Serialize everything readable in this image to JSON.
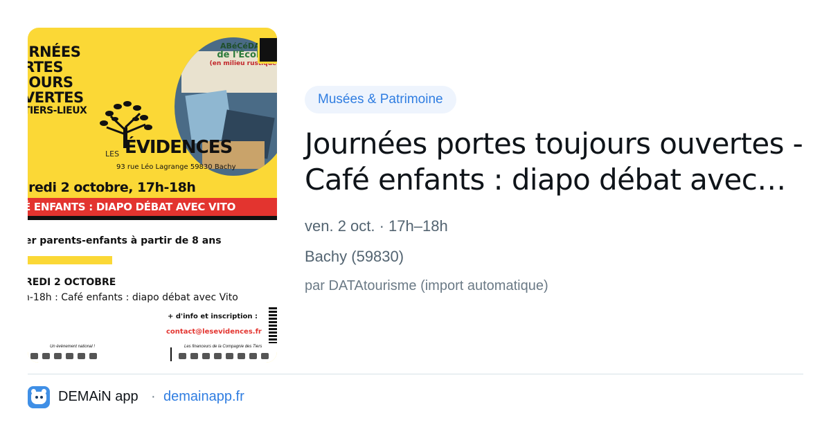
{
  "poster": {
    "title_lines": [
      "JRNÉES",
      "RTES",
      "JOURS",
      "VERTES",
      "TIERS-LIEUX"
    ],
    "circle_lines": [
      "ABéCéDAIR",
      "de l'Écolog",
      "(en milieu rustique)"
    ],
    "org_prefix": "LES",
    "org_name": "ÉVIDENCES",
    "address": "93 rue Léo Lagrange 59830 Bachy",
    "date_line": "dredi 2 octobre, 17h-18h",
    "red_banner": "É ENFANTS : DIAPO DÉBAT AVEC VITO",
    "audience": "er parents-enfants à partir de 8 ans",
    "day_heading": "REDI 2 OCTOBRE",
    "day_detail": "h-18h : Café enfants : diapo débat avec Vito",
    "info_label": "+ d'info et inscription :",
    "contact": "contact@lesevidences.fr",
    "footer_left": "Un évènement national !",
    "footer_right": "Les financeurs de la Compagnie des Tiers"
  },
  "category_badge": "Musées & Patrimoine",
  "event_title": "Journées portes toujours ouvertes - Café enfants : diapo débat avec…",
  "event_when": "ven. 2 oct. · 17h–18h",
  "event_where": "Bachy (59830)",
  "event_author": "par DATAtourisme (import automatique)",
  "footer": {
    "app_name": "DEMAiN app",
    "separator": "·",
    "domain": "demainapp.fr"
  },
  "colors": {
    "accent": "#2f7de1",
    "poster_yellow": "#fbd836",
    "poster_red": "#e3342f"
  }
}
